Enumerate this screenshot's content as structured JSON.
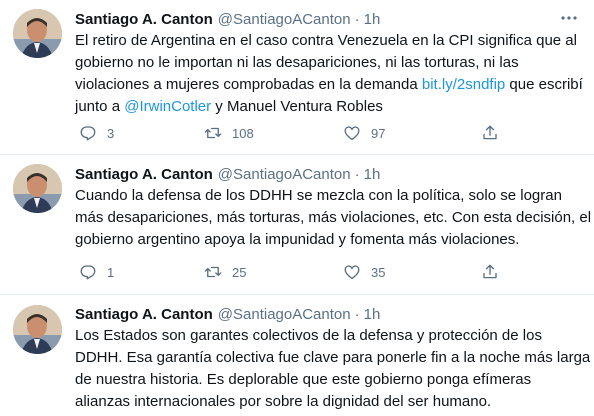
{
  "tweets": [
    {
      "name": "Santiago A. Canton",
      "handle": "@SantiagoACanton",
      "separator": "·",
      "time": "1h",
      "lines": [
        [
          {
            "t": "El retiro de Argentina en el caso contra Venezuela en la CPI significa que al"
          }
        ],
        [
          {
            "t": "gobierno no le importan ni las desapariciones, ni las torturas, ni las"
          }
        ],
        [
          {
            "t": "violaciones a mujeres comprobadas en la demanda "
          },
          {
            "t": "bit.ly/2sndfip",
            "link": true
          },
          {
            "t": " que escribí"
          }
        ],
        [
          {
            "t": "junto a "
          },
          {
            "t": "@IrwinCotler",
            "link": true
          },
          {
            "t": " y Manuel Ventura Robles"
          }
        ]
      ],
      "replies": "3",
      "retweets": "108",
      "likes": "97"
    },
    {
      "name": "Santiago A. Canton",
      "handle": "@SantiagoACanton",
      "separator": "·",
      "time": "1h",
      "lines": [
        [
          {
            "t": "Cuando la defensa de los DDHH se mezcla con la política, solo se logran"
          }
        ],
        [
          {
            "t": "más desapariciones, más torturas, más violaciones, etc. Con esta decisión, el"
          }
        ],
        [
          {
            "t": "gobierno argentino apoya la impunidad y fomenta más violaciones."
          }
        ]
      ],
      "replies": "1",
      "retweets": "25",
      "likes": "35"
    },
    {
      "name": "Santiago A. Canton",
      "handle": "@SantiagoACanton",
      "separator": "·",
      "time": "1h",
      "lines": [
        [
          {
            "t": "Los Estados son garantes colectivos de la defensa y protección de los"
          }
        ],
        [
          {
            "t": "DDHH. Esa garantía colectiva fue clave para ponerle fin a la noche más larga"
          }
        ],
        [
          {
            "t": "de nuestra historia. Es deplorable que este gobierno ponga efímeras"
          }
        ],
        [
          {
            "t": "alianzas internacionales por sobre la dignidad del ser humano."
          }
        ]
      ]
    }
  ],
  "icons": {
    "avatar": "profile-photo",
    "more": "more-options-icon",
    "reply": "reply-icon",
    "retweet": "retweet-icon",
    "like": "like-icon",
    "share": "share-icon"
  },
  "colors": {
    "text": "#0f1419",
    "secondary": "#5b7083",
    "link": "#1b95e0",
    "divider": "#e6ecf0"
  }
}
